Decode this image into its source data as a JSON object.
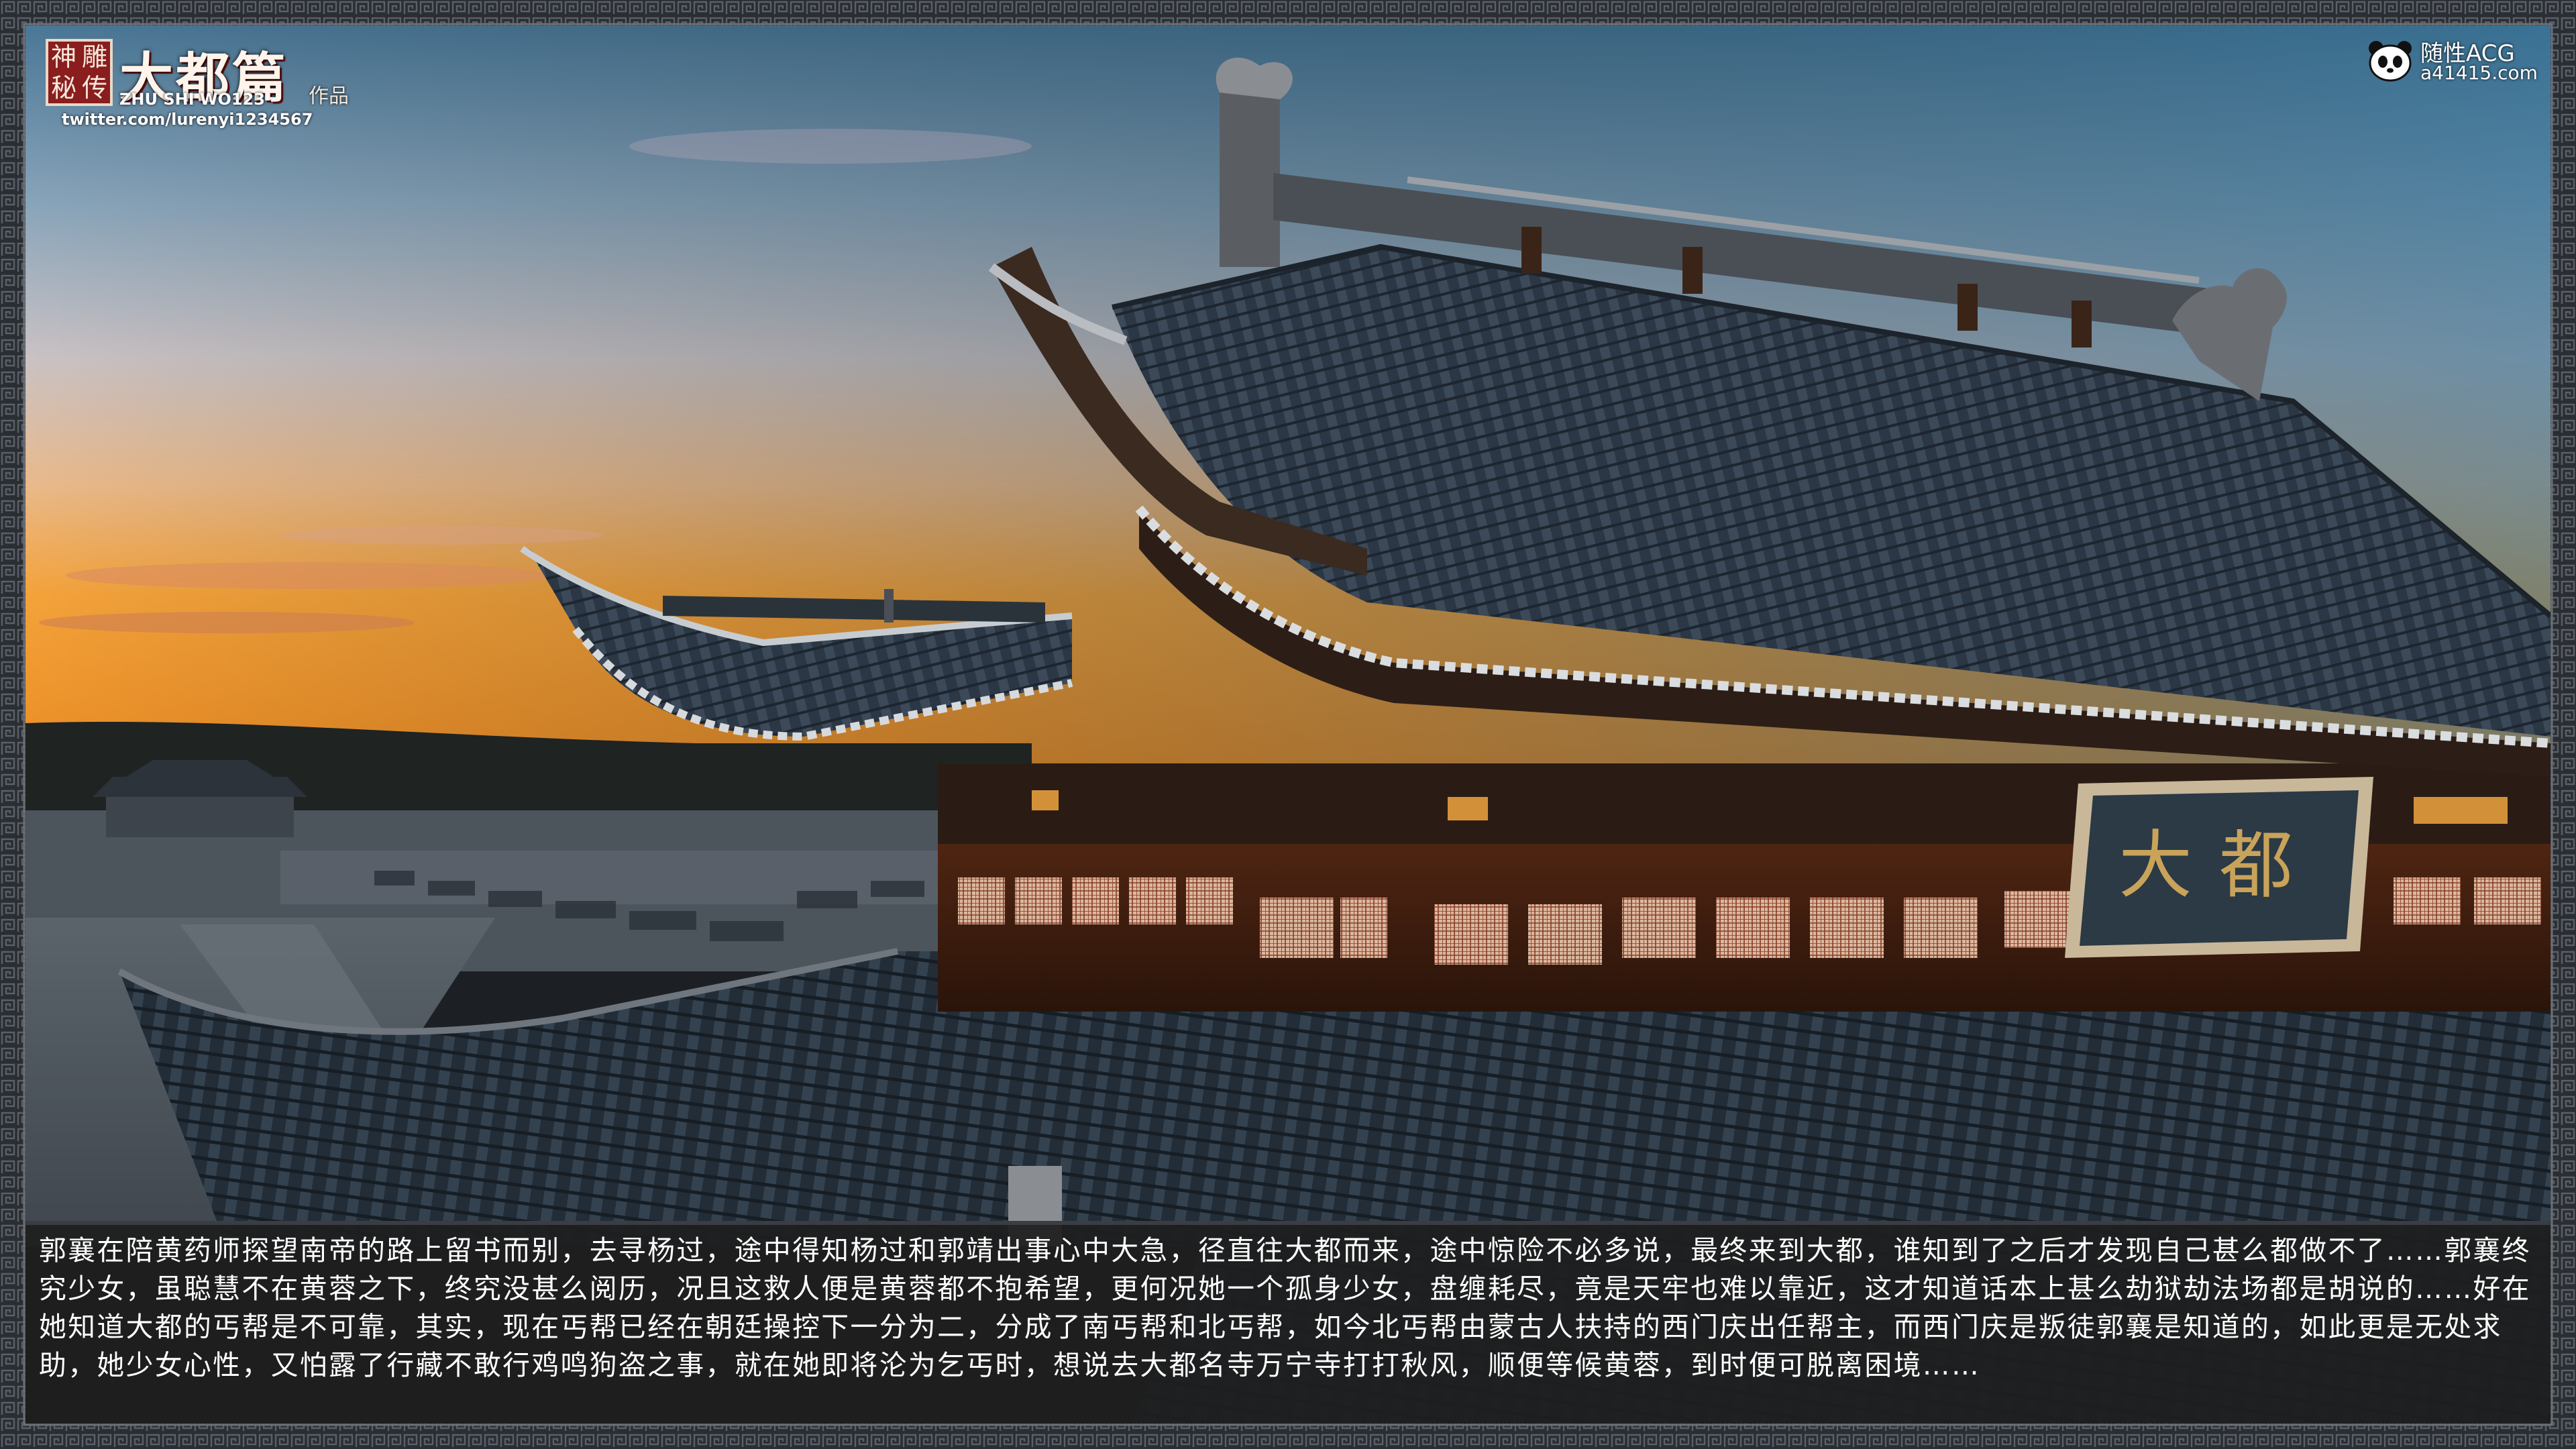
{
  "branding": {
    "seal_chars": [
      "神",
      "雕",
      "秘",
      "传"
    ],
    "series_title": "大都篇",
    "works_label": "作品",
    "author": "ZHU SHI WO123",
    "twitter": "twitter.com/lurenyi1234567"
  },
  "watermark": {
    "icon": "panda-icon",
    "name": "随性ACG",
    "url": "a41415.com"
  },
  "plaque_text": "大都",
  "caption": {
    "text": "郭襄在陪黄药师探望南帝的路上留书而别，去寻杨过，途中得知杨过和郭靖出事心中大急，径直往大都而来，途中惊险不必多说，最终来到大都，谁知到了之后才发现自己甚么都做不了……郭襄终究少女，虽聪慧不在黄蓉之下，终究没甚么阅历，况且这救人便是黄蓉都不抱希望，更何况她一个孤身少女，盘缠耗尽，竟是天牢也难以靠近，这才知道话本上甚么劫狱劫法场都是胡说的……好在她知道大都的丐帮是不可靠，其实，现在丐帮已经在朝廷操控下一分为二，分成了南丐帮和北丐帮，如今北丐帮由蒙古人扶持的西门庆出任帮主，而西门庆是叛徒郭襄是知道的，如此更是无处求助，她少女心性，又怕露了行藏不敢行鸡鸣狗盗之事，就在她即将沦为乞丐时，想说去大都名寺万宁寺打打秋风，顺便等候黄蓉，到时便可脱离困境……"
  },
  "colors": {
    "sky_top": "#3f6f8f",
    "sky_mid": "#8fa8bc",
    "horizon": "#f29a2c",
    "roof_tile": "#2e3a47",
    "frame": "#2c3036",
    "caption_bg": "#1e1e1e",
    "seal_red": "#8a1d1d"
  }
}
